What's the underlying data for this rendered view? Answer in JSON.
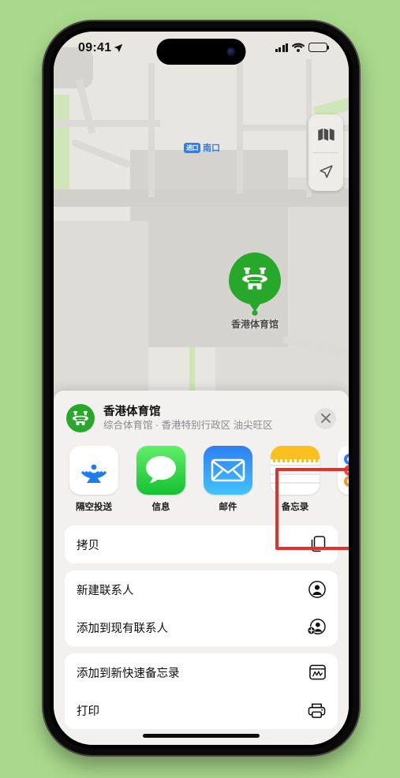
{
  "device": {
    "status_bar": {
      "time": "09:41",
      "location_arrow_icon": "location-arrow-icon",
      "cellular_icon": "cellular-signal-icon",
      "wifi_icon": "wifi-icon",
      "battery_icon": "battery-full-icon",
      "battery_level_percent": 100
    },
    "home_indicator": "home-indicator"
  },
  "map": {
    "entrance_marker": {
      "badge_label": "进口",
      "name": "南口"
    },
    "place_pin": {
      "label": "香港体育馆",
      "icon": "stadium-icon",
      "pin_color": "#27a82a"
    },
    "controls": [
      {
        "name": "map-type-button",
        "icon": "folded-map-icon"
      },
      {
        "name": "locate-me-button",
        "icon": "navigation-arrow-icon"
      }
    ],
    "base_color": "#e8e6e0",
    "road_color": "#d2d0cb",
    "park_color": "#cfe6b8"
  },
  "share_sheet": {
    "header": {
      "avatar_icon": "stadium-icon",
      "title": "香港体育馆",
      "subtitle": "综合体育馆 · 香港特别行政区 油尖旺区",
      "close_label": "✕",
      "close_icon": "close-icon"
    },
    "apps": [
      {
        "label": "隔空投送",
        "icon": "airdrop-icon",
        "highlighted": false
      },
      {
        "label": "信息",
        "icon": "messages-icon",
        "highlighted": false
      },
      {
        "label": "邮件",
        "icon": "mail-icon",
        "highlighted": false
      },
      {
        "label": "备忘录",
        "icon": "notes-icon",
        "highlighted": true
      },
      {
        "label": "提",
        "icon": "reminders-icon",
        "highlighted": false
      }
    ],
    "highlight_color": "#e8302a",
    "action_groups": [
      {
        "rows": [
          {
            "label": "拷贝",
            "icon": "copy-icon"
          }
        ]
      },
      {
        "rows": [
          {
            "label": "新建联系人",
            "icon": "person-circle-icon"
          },
          {
            "label": "添加到现有联系人",
            "icon": "person-add-icon"
          }
        ]
      },
      {
        "rows": [
          {
            "label": "添加到新快速备忘录",
            "icon": "quick-note-icon"
          },
          {
            "label": "打印",
            "icon": "printer-icon"
          }
        ]
      }
    ]
  },
  "background_color": "#a9d98c"
}
